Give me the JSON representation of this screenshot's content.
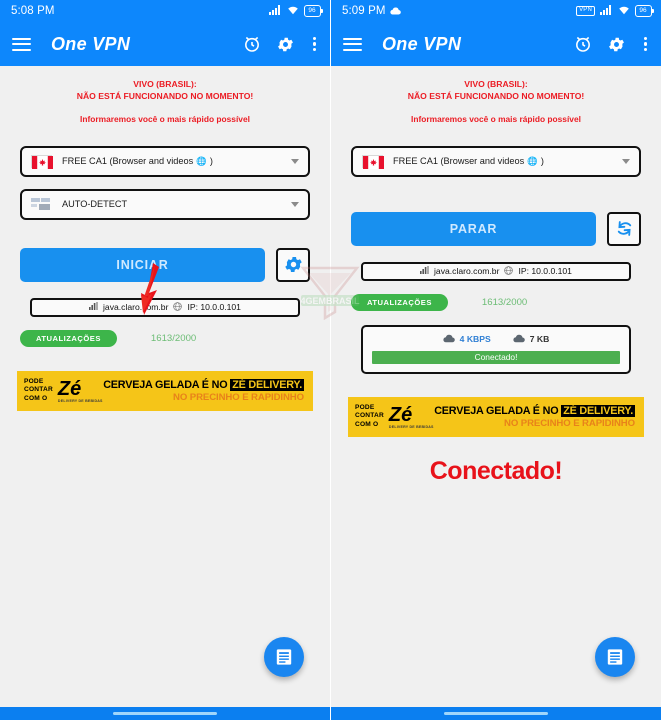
{
  "left": {
    "status": {
      "time": "5:08 PM",
      "cloud": false,
      "vpn": false,
      "battery": "96"
    },
    "appbar": {
      "title": "One VPN",
      "menu_icon": "hamburger-icon",
      "alarm_icon": "alarm-icon",
      "gear_icon": "gear-icon",
      "overflow_icon": "kebab-menu-icon"
    },
    "notice": {
      "line1": "VIVO (BRASIL):",
      "line2": "NÃO ESTÁ FUNCIONANDO NO MOMENTO!",
      "line3": "Informaremos você o mais rápido possível"
    },
    "server_select": {
      "label": "FREE CA1 (Browser and videos",
      "label_end": ")",
      "flag": "canada-flag-icon",
      "globe": "🌐"
    },
    "mode_select": {
      "label": "AUTO-DETECT",
      "icon": "auto-detect-icon"
    },
    "action": {
      "start_label": "INICIAR",
      "settings_icon": "gear-icon"
    },
    "ip": {
      "host": "java.claro.com.br",
      "globe": "🌐",
      "ip_label": "IP: 10.0.0.101",
      "signal_icon": "signal-bars-icon"
    },
    "updates": {
      "button": "ATUALIZAÇÕES",
      "count": "1613/2000"
    },
    "ad": {
      "pode": "PODE",
      "contar": "CONTAR",
      "como": "COM O",
      "brand": "Zé",
      "brand_sub": "DELIVERY DE BEBIDAS",
      "line1_a": "CERVEJA GELADA É NO ",
      "line1_b": "ZÉ DELIVERY.",
      "line2": "NO PRECINHO E RAPIDINHO"
    },
    "fab": {
      "icon": "document-list-icon"
    }
  },
  "right": {
    "status": {
      "time": "5:09 PM",
      "cloud": true,
      "vpn": "VPN",
      "battery": "96"
    },
    "appbar": {
      "title": "One VPN",
      "menu_icon": "hamburger-icon",
      "alarm_icon": "alarm-icon",
      "gear_icon": "gear-icon",
      "overflow_icon": "kebab-menu-icon"
    },
    "notice": {
      "line1": "VIVO (BRASIL):",
      "line2": "NÃO ESTÁ FUNCIONANDO NO MOMENTO!",
      "line3": "Informaremos você o mais rápido possível"
    },
    "server_select": {
      "label": "FREE CA1 (Browser and videos",
      "label_end": ")",
      "flag": "canada-flag-icon",
      "globe": "🌐"
    },
    "action": {
      "stop_label": "PARAR",
      "refresh_icon": "refresh-sync-icon"
    },
    "ip": {
      "host": "java.claro.com.br",
      "globe": "🌐",
      "ip_label": "IP: 10.0.0.101",
      "signal_icon": "signal-bars-icon"
    },
    "updates": {
      "button": "ATUALIZAÇÕES",
      "count": "1613/2000"
    },
    "traffic": {
      "down_value": "4 KBPS",
      "up_value": "7 KB",
      "down_icon": "cloud-download-icon",
      "up_icon": "cloud-upload-icon",
      "status": "Conectado!"
    },
    "ad": {
      "pode": "PODE",
      "contar": "CONTAR",
      "como": "COM O",
      "brand": "Zé",
      "brand_sub": "DELIVERY DE BEBIDAS",
      "line1_a": "CERVEJA GELADA É NO ",
      "line1_b": "ZÉ DELIVERY.",
      "line2": "NO PRECINHO E RAPIDINHO"
    },
    "big_status": "Conectado!",
    "fab": {
      "icon": "document-list-icon"
    }
  },
  "colors": {
    "appbar_blue": "#0d87fc",
    "button_blue": "#1890ef",
    "green": "#3db54a",
    "red": "#ec1c24",
    "ad_yellow": "#f5c518",
    "background": "#f0f0f0"
  }
}
